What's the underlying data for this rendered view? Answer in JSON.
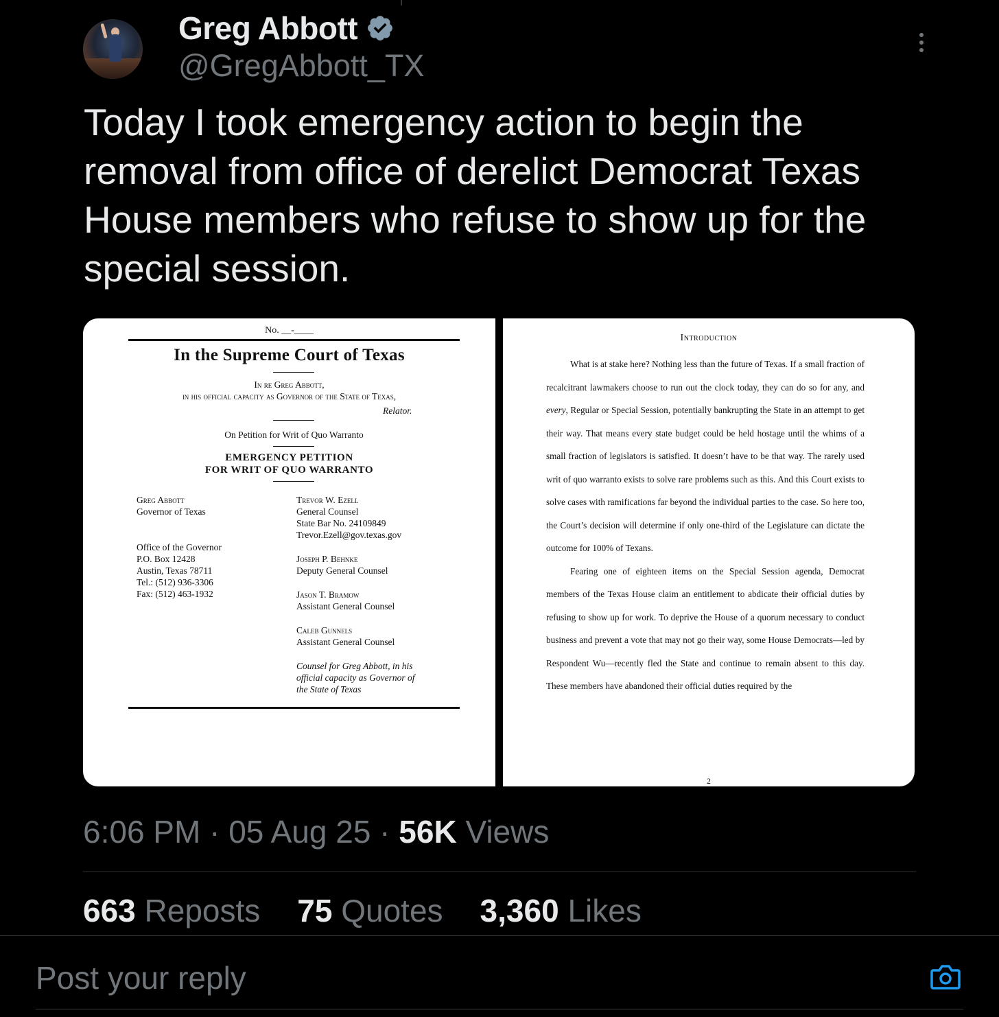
{
  "author": {
    "display_name": "Greg Abbott",
    "handle": "@GregAbbott_TX"
  },
  "tweet": {
    "text": "Today I took emergency action to begin the removal from office of derelict Democrat Texas House members who refuse to show up for the special session."
  },
  "document_left": {
    "number": "No. __-____",
    "court": "In the Supreme Court of Texas",
    "in_re_1": "In re Greg Abbott,",
    "in_re_2": "in his official capacity as Governor of the State of Texas,",
    "relator": "Relator.",
    "petition_line": "On Petition for Writ of Quo Warranto",
    "title_1": "EMERGENCY PETITION",
    "title_2": "FOR WRIT OF QUO WARRANTO",
    "left_col": {
      "name": "Greg Abbott",
      "role": "Governor of Texas",
      "office": "Office of the Governor",
      "box": "P.O. Box 12428",
      "city": "Austin, Texas 78711",
      "tel": "Tel.: (512) 936-3306",
      "fax": "Fax: (512) 463-1932"
    },
    "right_col": {
      "c1_name": "Trevor W. Ezell",
      "c1_role": "General Counsel",
      "c1_bar": "State Bar No. 24109849",
      "c1_email": "Trevor.Ezell@gov.texas.gov",
      "c2_name": "Joseph P. Behnke",
      "c2_role": "Deputy General Counsel",
      "c3_name": "Jason T. Bramow",
      "c3_role": "Assistant General Counsel",
      "c4_name": "Caleb Gunnels",
      "c4_role": "Assistant General Counsel",
      "counsel_1": "Counsel for Greg Abbott, in his",
      "counsel_2": "official capacity as Governor of",
      "counsel_3": "the State of Texas"
    }
  },
  "document_right": {
    "heading": "Introduction",
    "para1_a": "What is at stake here? Nothing less than the future of Texas. If a small fraction of recalcitrant lawmakers choose to run out the clock today, they can do so for any, and ",
    "para1_em": "every",
    "para1_b": ", Regular or Special Session, potentially bankrupting the State in an attempt to get their way. That means every state budget could be held hostage until the whims of a small fraction of legislators is satisfied. It doesn’t have to be that way. The rarely used writ of quo warranto exists to solve rare problems such as this. And this Court exists to solve cases with ramifications far beyond the individual parties to the case. So here too, the Court’s decision will determine if only one-third of the Legislature can dictate the outcome for 100% of Texans.",
    "para2": "Fearing one of eighteen items on the Special Session agenda, Democrat members of the Texas House claim an entitlement to abdicate their official duties by refusing to show up for work. To deprive the House of a quorum necessary to conduct business and prevent a vote that may not go their way, some House Democrats—led by Respondent Wu—recently fled the State and continue to remain absent to this day. These members have abandoned their official duties required by the",
    "page_number": "2"
  },
  "meta": {
    "time": "6:06 PM",
    "sep1": " · ",
    "date": "05 Aug 25",
    "sep2": " · ",
    "views_count": "56K",
    "views_label": " Views"
  },
  "stats": {
    "reposts_count": "663",
    "reposts_label": " Reposts",
    "quotes_count": "75",
    "quotes_label": " Quotes",
    "likes_count": "3,360",
    "likes_label": " Likes"
  },
  "reply": {
    "placeholder": "Post your reply"
  },
  "colors": {
    "background": "#000000",
    "text_primary": "#e7e9ea",
    "text_secondary": "#71767b",
    "verified_badge": "#829aab",
    "accent": "#1d9bf0"
  },
  "icons": {
    "verified": "verified-badge-icon",
    "more": "more-options-icon",
    "camera": "camera-icon"
  }
}
